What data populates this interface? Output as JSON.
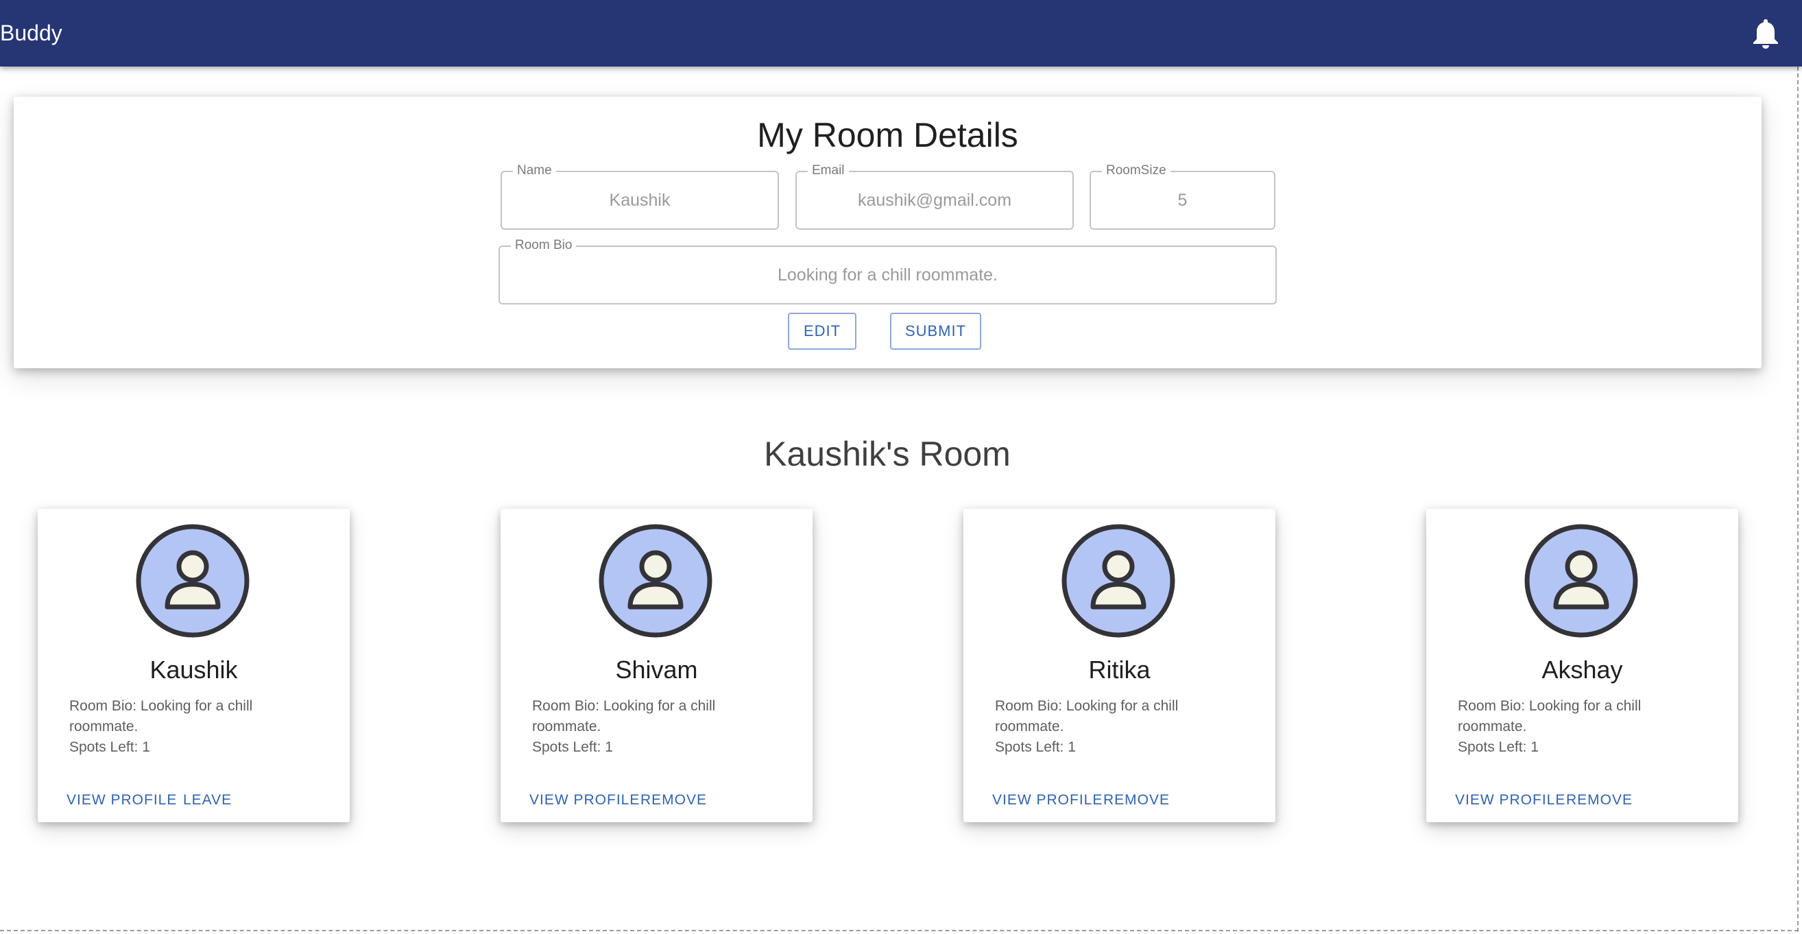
{
  "appbar": {
    "brand": "Buddy",
    "notification_icon": "bell-icon",
    "color": "#263574"
  },
  "details": {
    "title": "My Room Details",
    "name": {
      "label": "Name",
      "value": "Kaushik"
    },
    "email": {
      "label": "Email",
      "value": "kaushik@gmail.com"
    },
    "room_size": {
      "label": "RoomSize",
      "value": "5"
    },
    "room_bio": {
      "label": "Room Bio",
      "value": "Looking for a chill roommate."
    },
    "edit_label": "EDIT",
    "submit_label": "SUBMIT"
  },
  "room": {
    "title": "Kaushik's Room",
    "members": [
      {
        "name": "Kaushik",
        "bio": "Room Bio: Looking for a chill roommate.",
        "spots": "Spots Left: 1",
        "view_label": "VIEW PROFILE",
        "action_label": "LEAVE"
      },
      {
        "name": "Shivam",
        "bio": "Room Bio: Looking for a chill roommate.",
        "spots": "Spots Left: 1",
        "view_label": "VIEW PROFILE",
        "action_label": "REMOVE"
      },
      {
        "name": "Ritika",
        "bio": "Room Bio: Looking for a chill roommate.",
        "spots": "Spots Left: 1",
        "view_label": "VIEW PROFILE",
        "action_label": "REMOVE"
      },
      {
        "name": "Akshay",
        "bio": "Room Bio: Looking for a chill roommate.",
        "spots": "Spots Left: 1",
        "view_label": "VIEW PROFILE",
        "action_label": "REMOVE"
      }
    ],
    "avatar_icon": "user-avatar-icon",
    "avatar_color": "#b3c5f5",
    "accent_color": "#2f63b6"
  }
}
